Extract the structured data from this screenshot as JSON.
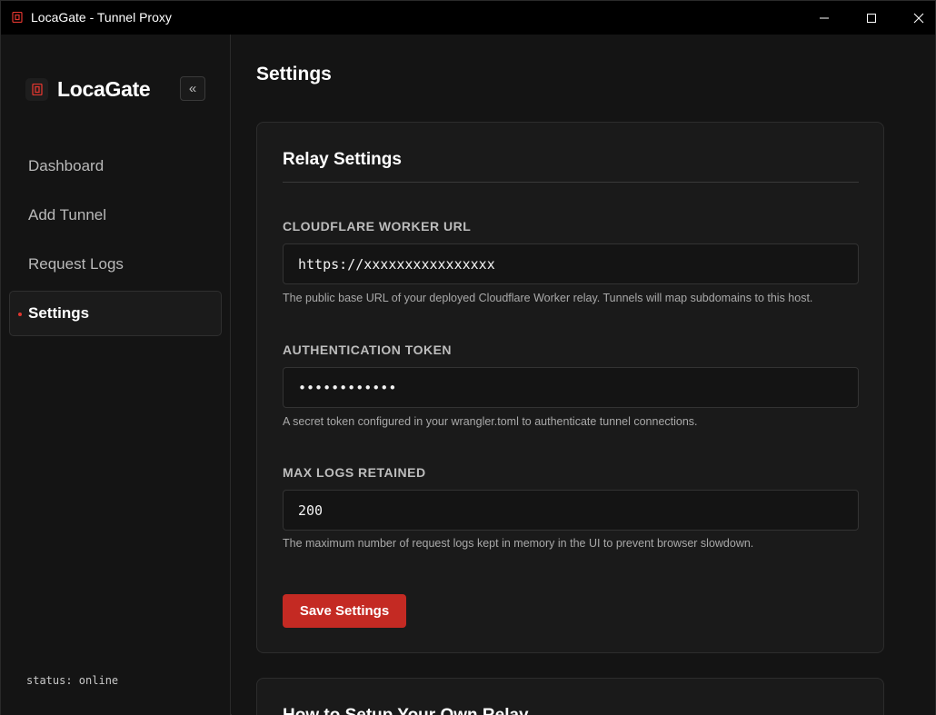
{
  "window": {
    "title": "LocaGate - Tunnel Proxy",
    "accent_color": "#e0362f",
    "controls": [
      "minimize-icon",
      "maximize-icon",
      "close-icon"
    ]
  },
  "sidebar": {
    "brand": "LocaGate",
    "collapse_label": "«",
    "items": [
      {
        "label": "Dashboard",
        "active": false
      },
      {
        "label": "Add Tunnel",
        "active": false
      },
      {
        "label": "Request Logs",
        "active": false
      },
      {
        "label": "Settings",
        "active": true
      }
    ],
    "status": "status: online"
  },
  "main": {
    "page_title": "Settings",
    "relay_card": {
      "title": "Relay Settings",
      "fields": [
        {
          "label": "CLOUDFLARE WORKER URL",
          "value": "https://xxxxxxxxxxxxxxxx",
          "help": "The public base URL of your deployed Cloudflare Worker relay. Tunnels will map subdomains to this host."
        },
        {
          "label": "AUTHENTICATION TOKEN",
          "value": "••••••••••••",
          "help": "A secret token configured in your wrangler.toml to authenticate tunnel connections."
        },
        {
          "label": "MAX LOGS RETAINED",
          "value": "200",
          "help": "The maximum number of request logs kept in memory in the UI to prevent browser slowdown."
        }
      ],
      "save_label": "Save Settings",
      "save_color": "#c42a23"
    },
    "howto_card": {
      "title": "How to Setup Your Own Relay"
    }
  }
}
